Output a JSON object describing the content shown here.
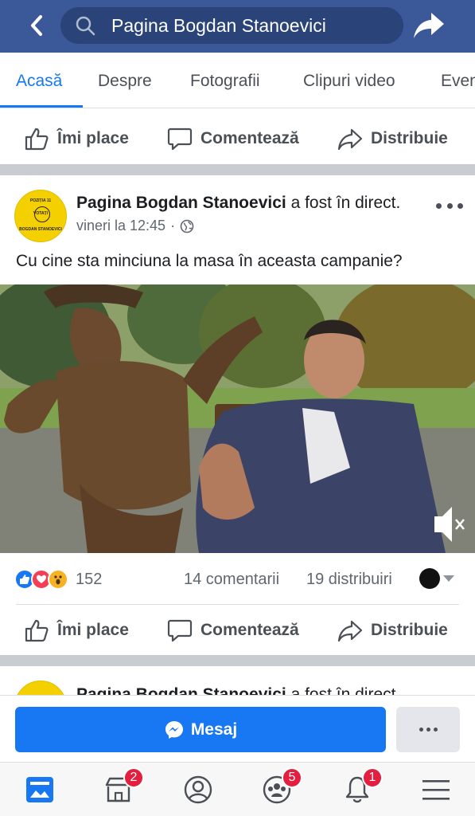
{
  "header": {
    "search_text": "Pagina Bogdan Stanoevici"
  },
  "tabs": [
    {
      "label": "Acasă"
    },
    {
      "label": "Despre"
    },
    {
      "label": "Fotografii"
    },
    {
      "label": "Clipuri video"
    },
    {
      "label": "Evenimente"
    }
  ],
  "actions": {
    "like": "Îmi place",
    "comment": "Comentează",
    "share": "Distribuie"
  },
  "post": {
    "author": "Pagina Bogdan Stanoevici",
    "author_suffix": " a fost în direct.",
    "time": "vineri la 12:45",
    "privacy_icon": "globe-icon",
    "text": "Cu cine sta minciuna la masa în aceasta campanie?",
    "avatar_lines": [
      "POZIȚIA 11",
      "VOTAȚI",
      "BOGDAN STANOEVICI"
    ]
  },
  "reactions": {
    "count": "152",
    "comments": "14 comentarii",
    "shares": "19 distribuiri"
  },
  "next_post": {
    "author": "Pagina Bogdan Stanoevici",
    "author_suffix": " a fost în direct."
  },
  "message_bar": {
    "mesaj_label": "Mesaj"
  },
  "bottom_nav": {
    "badges": {
      "marketplace": "2",
      "groups": "5",
      "notifications": "1"
    }
  },
  "colors": {
    "header_bg": "#3b5998",
    "accent": "#1877f2",
    "badge": "#e41e3f"
  }
}
